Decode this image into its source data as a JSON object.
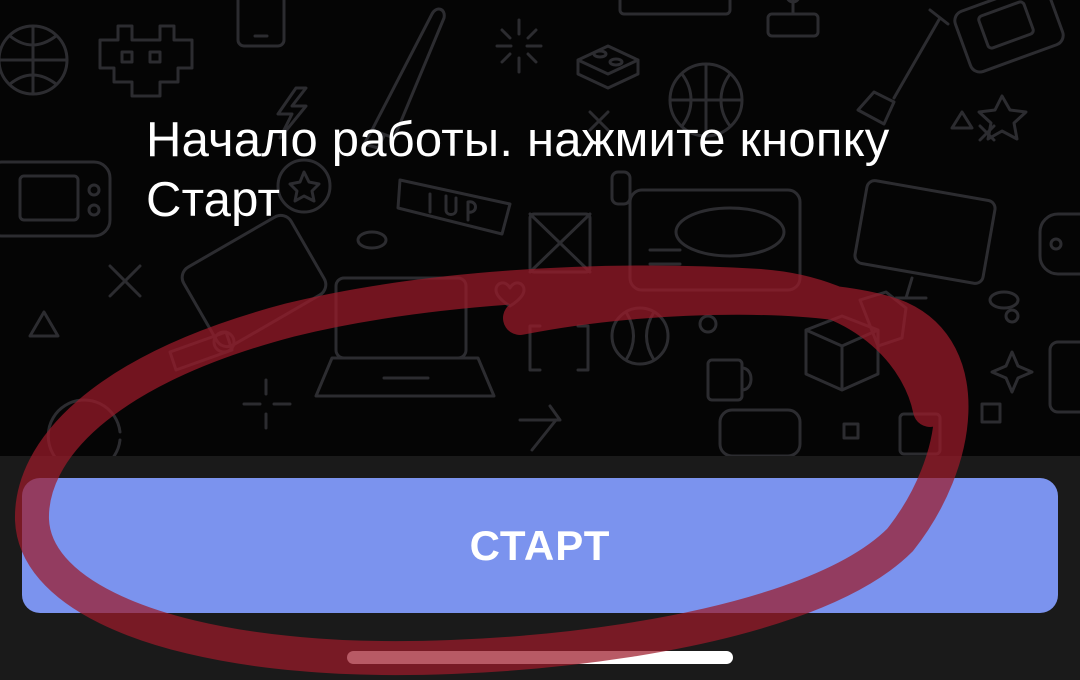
{
  "screen": {
    "message": "Начало работы. нажмите кнопку Старт",
    "background_pattern": "doodle-gaming-icons"
  },
  "actions": {
    "start_label": "СТАРТ"
  },
  "system": {
    "home_indicator": "home-indicator"
  },
  "colors": {
    "background": "#050505",
    "pattern_stroke": "#2c2c30",
    "bottom_bar": "#1a1a1a",
    "button": "#7b93ee",
    "button_text": "#ffffff",
    "annotation": "#9c1a2a"
  }
}
